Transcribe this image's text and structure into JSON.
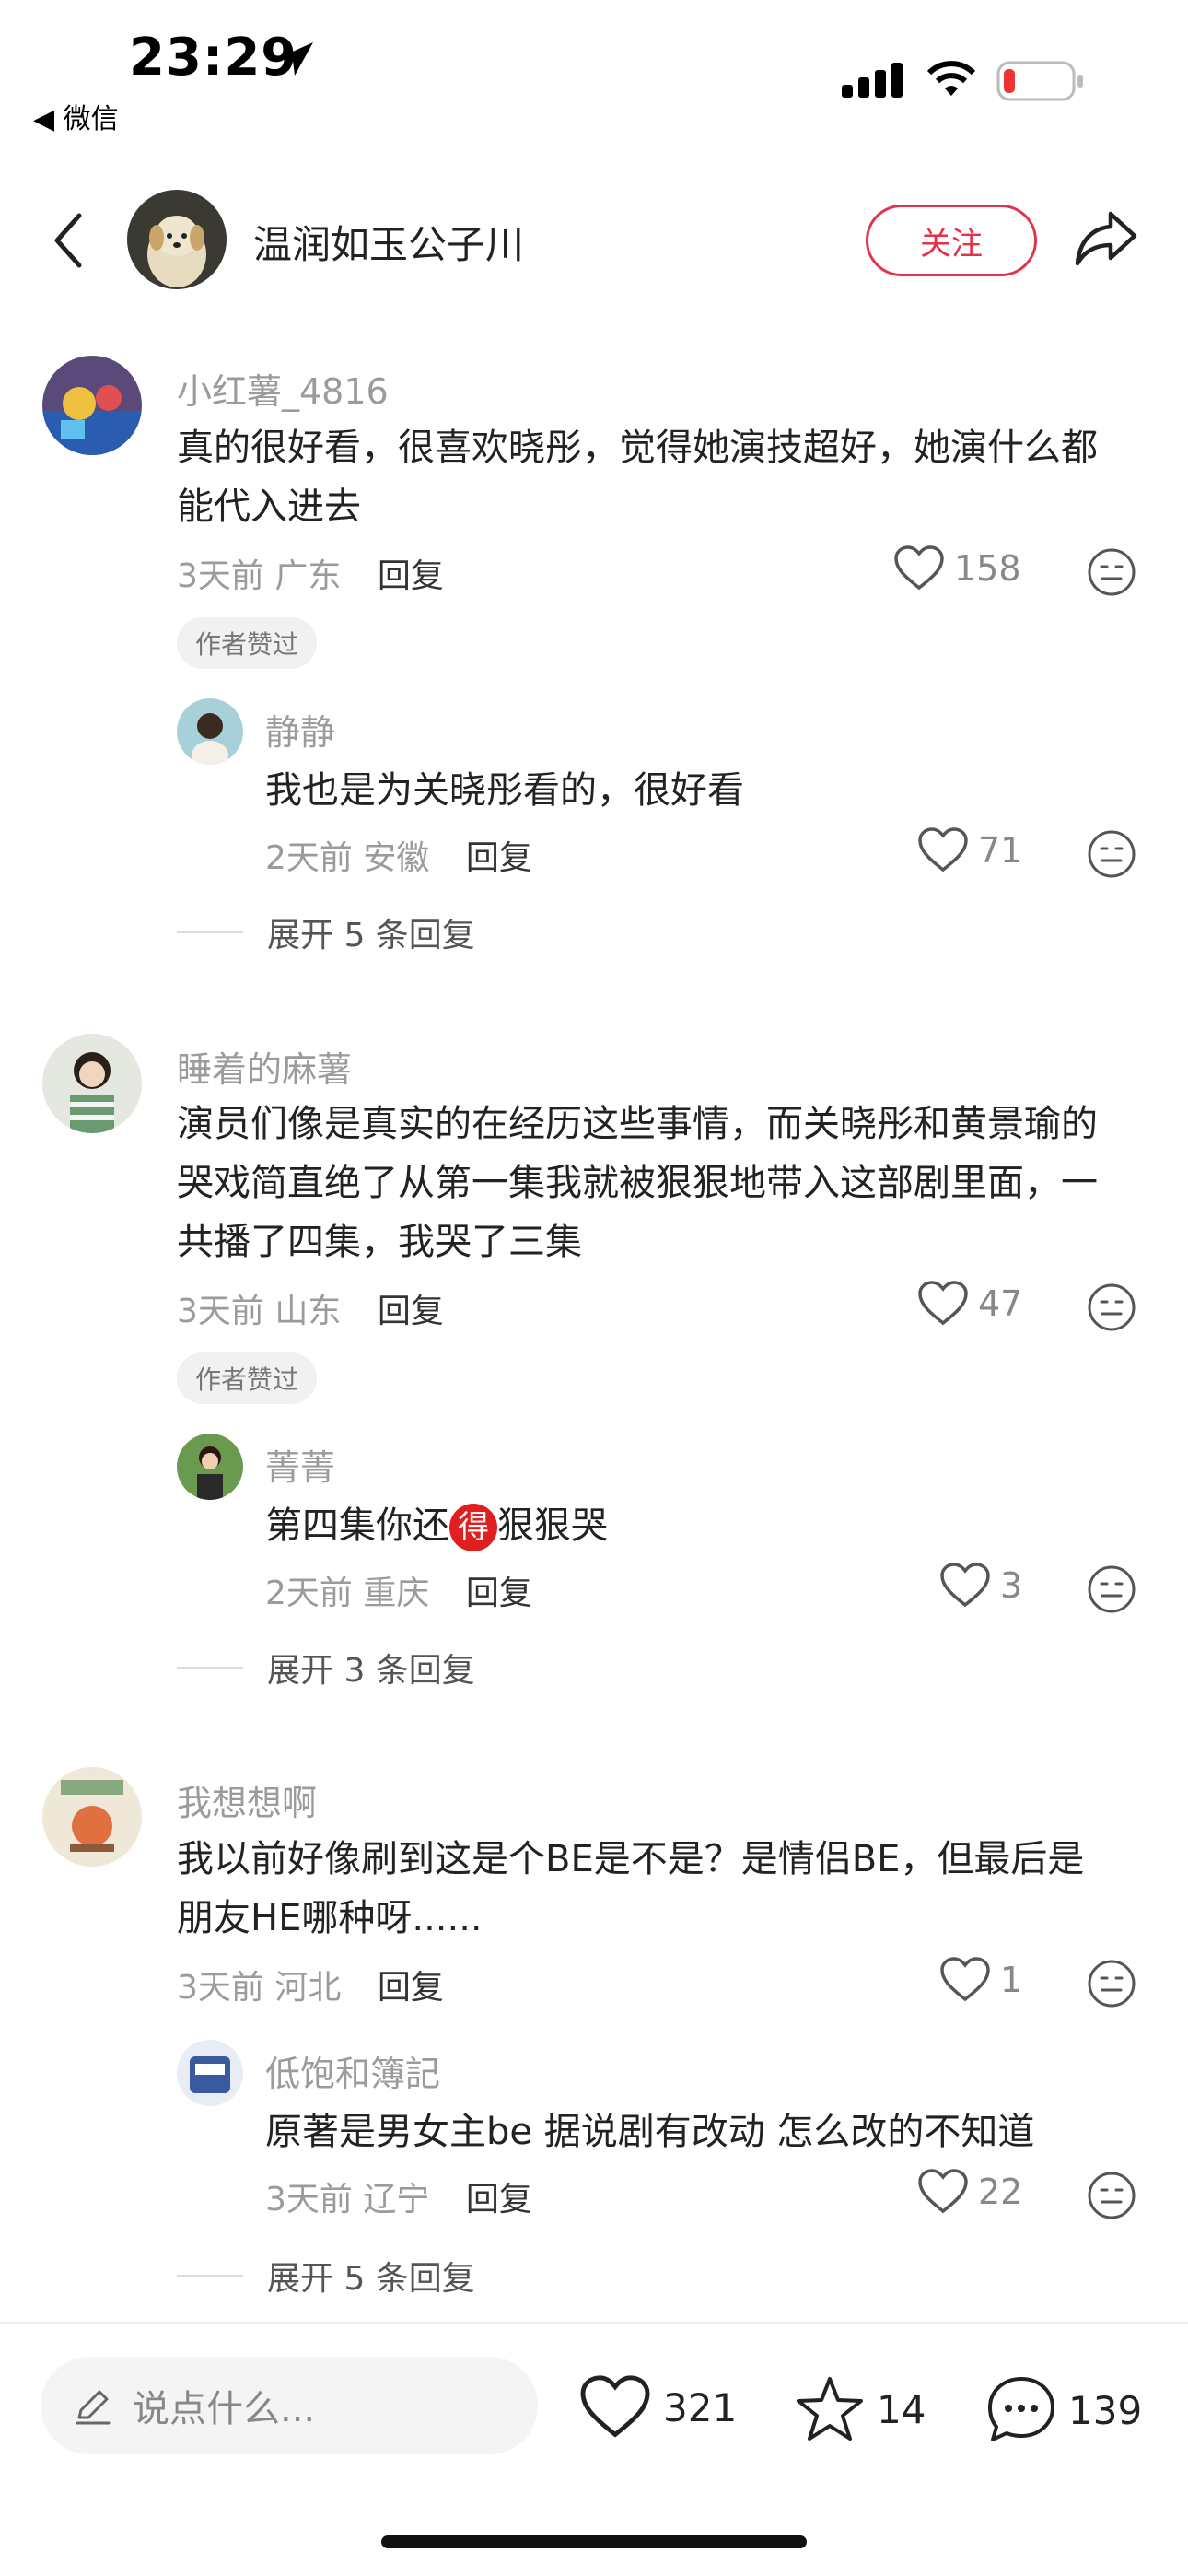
{
  "status_bar": {
    "time": "23:29",
    "back_app": "◀ 微信"
  },
  "header": {
    "author_name": "温润如玉公子川",
    "follow_label": "关注"
  },
  "colors": {
    "accent": "#e3324a",
    "muted": "#9b9b9b"
  },
  "comments": [
    {
      "user": "小红薯_4816",
      "text_lines": [
        "真的很好看，很喜欢晓彤，觉得她演技超好，她演什么都",
        "能代入进去"
      ],
      "time": "3天前",
      "location": "广东",
      "reply_label": "回复",
      "likes": "158",
      "badge": "作者赞过",
      "reply": {
        "user": "静静",
        "text": "我也是为关晓彤看的，很好看",
        "time": "2天前",
        "location": "安徽",
        "reply_label": "回复",
        "likes": "71"
      },
      "expand": "展开 5 条回复"
    },
    {
      "user": "睡着的麻薯",
      "text_lines": [
        "演员们像是真实的在经历这些事情，而关晓彤和黄景瑜的",
        "哭戏简直绝了从第一集我就被狠狠地带入这部剧里面，一",
        "共播了四集，我哭了三集"
      ],
      "time": "3天前",
      "location": "山东",
      "reply_label": "回复",
      "likes": "47",
      "badge": "作者赞过",
      "reply": {
        "user": "菁菁",
        "text_before": "第四集你还",
        "text_emoji": "得",
        "text_after": "狠狠哭",
        "time": "2天前",
        "location": "重庆",
        "reply_label": "回复",
        "likes": "3"
      },
      "expand": "展开 3 条回复"
    },
    {
      "user": "我想想啊",
      "text_lines": [
        "我以前好像刷到这是个BE是不是？是情侣BE，但最后是",
        "朋友HE哪种呀......"
      ],
      "time": "3天前",
      "location": "河北",
      "reply_label": "回复",
      "likes": "1",
      "reply": {
        "user": "低饱和簿記",
        "text": "原著是男女主be 据说剧有改动 怎么改的不知道",
        "time": "3天前",
        "location": "辽宁",
        "reply_label": "回复",
        "likes": "22"
      },
      "expand": "展开 5 条回复"
    }
  ],
  "bottom_bar": {
    "input_placeholder": "说点什么...",
    "likes": "321",
    "stars": "14",
    "comments": "139"
  }
}
